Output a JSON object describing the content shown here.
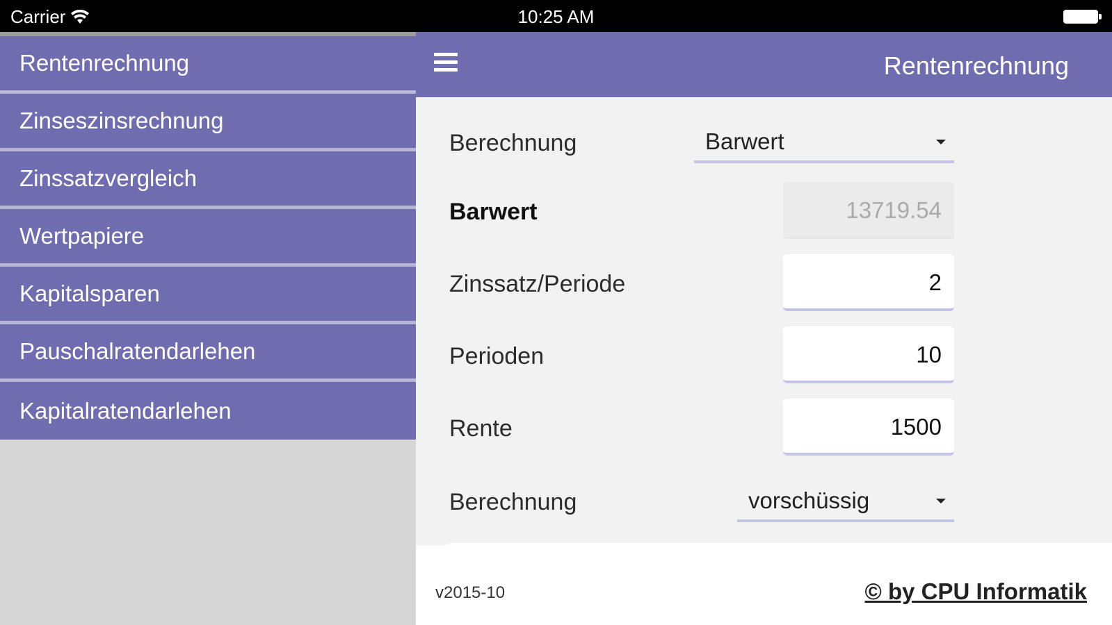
{
  "status_bar": {
    "carrier": "Carrier",
    "time": "10:25 AM",
    "wifi_icon": "wifi-icon",
    "battery_icon": "battery-icon"
  },
  "sidebar": {
    "items": [
      {
        "label": "Rentenrechnung"
      },
      {
        "label": "Zinseszinsrechnung"
      },
      {
        "label": "Zinssatzvergleich"
      },
      {
        "label": "Wertpapiere"
      },
      {
        "label": "Kapitalsparen"
      },
      {
        "label": "Pauschalratendarlehen"
      },
      {
        "label": "Kapitalratendarlehen"
      }
    ]
  },
  "header": {
    "title": "Rentenrechnung",
    "menu_icon": "hamburger-menu-icon"
  },
  "form": {
    "calc_type": {
      "label": "Berechnung",
      "value": "Barwert"
    },
    "barwert": {
      "label": "Barwert",
      "value": "13719.54"
    },
    "zinssatz": {
      "label": "Zinssatz/Periode",
      "value": "2"
    },
    "perioden": {
      "label": "Perioden",
      "value": "10"
    },
    "rente": {
      "label": "Rente",
      "value": "1500"
    },
    "timing": {
      "label": "Berechnung",
      "value": "vorschüssig"
    }
  },
  "footer": {
    "version": "v2015-10",
    "copyright": "© by CPU Informatik"
  },
  "colors": {
    "accent": "#706cb0",
    "sidebar_divider": "#b9b7d6",
    "content_bg": "#f2f2f2",
    "field_underline": "#c5c4e6"
  }
}
